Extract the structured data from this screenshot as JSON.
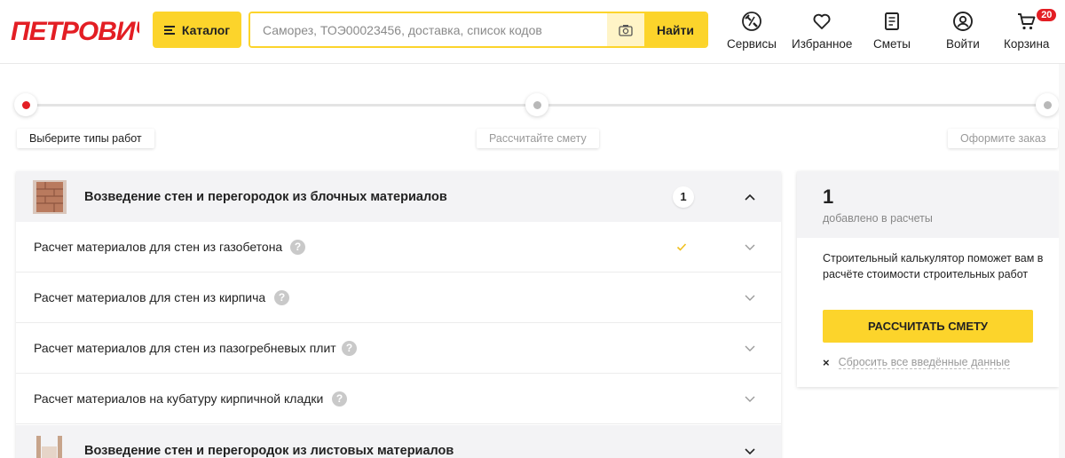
{
  "header": {
    "logo_text": "ПЕТРОВИЧ",
    "catalog_label": "Каталог",
    "search_placeholder": "Саморез, ТОЭ00023456, доставка, список кодов",
    "search_button": "Найти",
    "nav": [
      {
        "label": "Сервисы",
        "icon": "services-icon"
      },
      {
        "label": "Избранное",
        "icon": "heart-icon"
      },
      {
        "label": "Сметы",
        "icon": "document-icon"
      },
      {
        "label": "Войти",
        "icon": "user-icon"
      },
      {
        "label": "Корзина",
        "icon": "cart-icon",
        "badge": "20"
      }
    ]
  },
  "stepper": {
    "steps": [
      {
        "label": "Выберите типы работ",
        "active": true
      },
      {
        "label": "Рассчитайте смету",
        "active": false
      },
      {
        "label": "Оформите заказ",
        "active": false
      }
    ]
  },
  "groups": [
    {
      "title": "Возведение стен и перегородок из блочных материалов",
      "count": "1",
      "expanded": true,
      "items": [
        {
          "title": "Расчет материалов для стен из газобетона",
          "help": "?",
          "selected": true
        },
        {
          "title": "Расчет материалов для стен из кирпича",
          "help": "?",
          "selected": false
        },
        {
          "title": "Расчет материалов для стен из пазогребневых плит",
          "help": "?",
          "selected": false
        },
        {
          "title": "Расчет материалов на кубатуру кирпичной кладки",
          "help": "?",
          "selected": false
        }
      ]
    },
    {
      "title": "Возведение стен и перегородок из листовых материалов",
      "expanded": false
    }
  ],
  "summary": {
    "count": "1",
    "count_label": "добавлено в расчеты",
    "description": "Строительный калькулятор поможет вам в расчёте стоимости строительных работ",
    "calc_button": "РАССЧИТАТЬ СМЕТУ",
    "reset_label": "Сбросить все введённые данные"
  },
  "colors": {
    "brand_red": "#e31e24",
    "accent_yellow": "#fcd42b"
  }
}
